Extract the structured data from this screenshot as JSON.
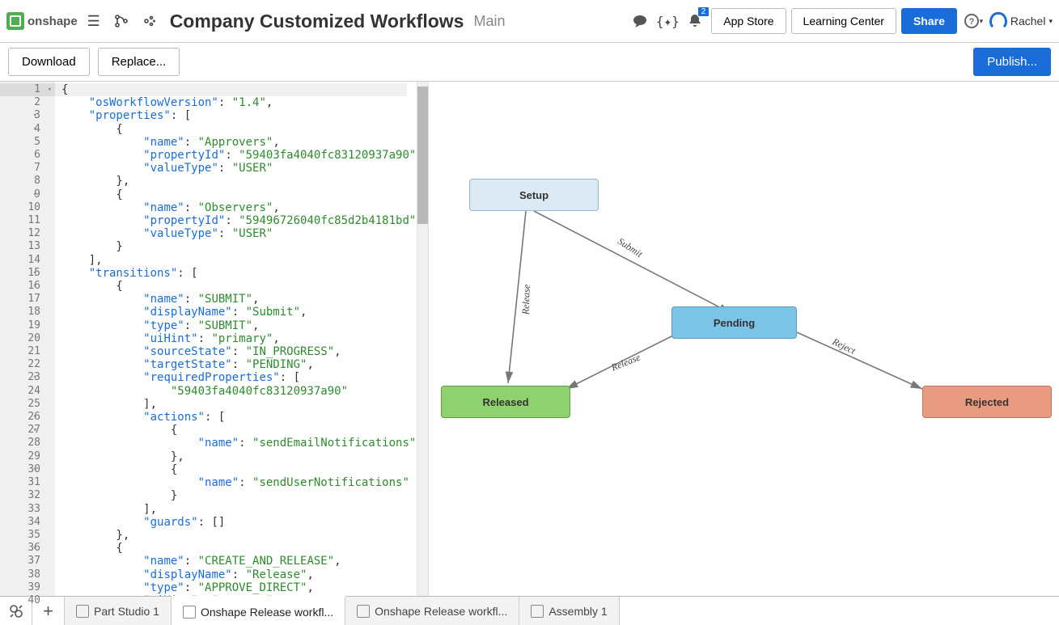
{
  "header": {
    "brand": "onshape",
    "title": "Company Customized Workflows",
    "branch": "Main",
    "notification_count": "2",
    "app_store": "App Store",
    "learning_center": "Learning Center",
    "share": "Share",
    "user_name": "Rachel"
  },
  "toolbar": {
    "download": "Download",
    "replace": "Replace...",
    "publish": "Publish..."
  },
  "editor": {
    "first_line": 1,
    "fold_lines": [
      1,
      3,
      4,
      9,
      15,
      16,
      23,
      26,
      27,
      30,
      36
    ],
    "lines": [
      "{",
      "    \"osWorkflowVersion\": \"1.4\",",
      "    \"properties\": [",
      "        {",
      "            \"name\": \"Approvers\",",
      "            \"propertyId\": \"59403fa4040fc83120937a90\",",
      "            \"valueType\": \"USER\"",
      "        },",
      "        {",
      "            \"name\": \"Observers\",",
      "            \"propertyId\": \"59496726040fc85d2b4181bd\",",
      "            \"valueType\": \"USER\"",
      "        }",
      "    ],",
      "    \"transitions\": [",
      "        {",
      "            \"name\": \"SUBMIT\",",
      "            \"displayName\": \"Submit\",",
      "            \"type\": \"SUBMIT\",",
      "            \"uiHint\": \"primary\",",
      "            \"sourceState\": \"IN_PROGRESS\",",
      "            \"targetState\": \"PENDING\",",
      "            \"requiredProperties\": [",
      "                \"59403fa4040fc83120937a90\"",
      "            ],",
      "            \"actions\": [",
      "                {",
      "                    \"name\": \"sendEmailNotifications\"",
      "                },",
      "                {",
      "                    \"name\": \"sendUserNotifications\"",
      "                }",
      "            ],",
      "            \"guards\": []",
      "        },",
      "        {",
      "            \"name\": \"CREATE_AND_RELEASE\",",
      "            \"displayName\": \"Release\",",
      "            \"type\": \"APPROVE_DIRECT\",",
      "            \"uiHint\": \"success\","
    ]
  },
  "diagram": {
    "nodes": {
      "setup": "Setup",
      "pending": "Pending",
      "released": "Released",
      "rejected": "Rejected"
    },
    "edges": {
      "submit": "Submit",
      "release_setup": "Release",
      "release_pending": "Release",
      "reject": "Reject"
    }
  },
  "tabs": {
    "items": [
      {
        "label": "Part Studio 1"
      },
      {
        "label": "Onshape Release workfl..."
      },
      {
        "label": "Onshape Release workfl..."
      },
      {
        "label": "Assembly 1"
      }
    ],
    "active_index": 1
  }
}
